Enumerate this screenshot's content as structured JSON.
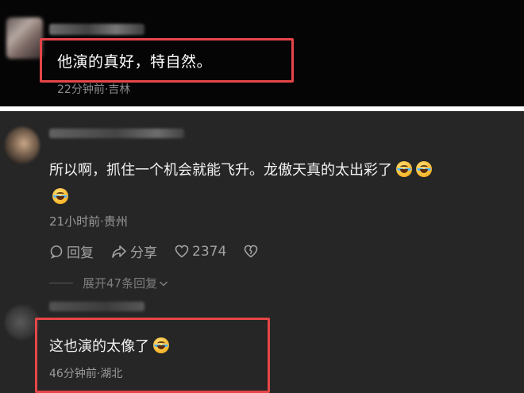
{
  "comment_top": {
    "text": "他演的真好，特自然。",
    "meta": "22分钟前·吉林"
  },
  "comment_main": {
    "text": "所以啊，抓住一个机会就能飞升。龙傲天真的太出彩了",
    "emoji_count": 3,
    "emoji_icon": "laugh-cry-icon",
    "meta": "21小时前·贵州",
    "actions": {
      "reply_label": "回复",
      "share_label": "分享",
      "like_count": "2374"
    },
    "expand_label": "展开47条回复"
  },
  "comment_bottom": {
    "text": "这也演的太像了",
    "meta": "46分钟前·湖北"
  },
  "colors": {
    "highlight": "#e64548",
    "top_background": "#050505",
    "main_background": "#262626"
  }
}
